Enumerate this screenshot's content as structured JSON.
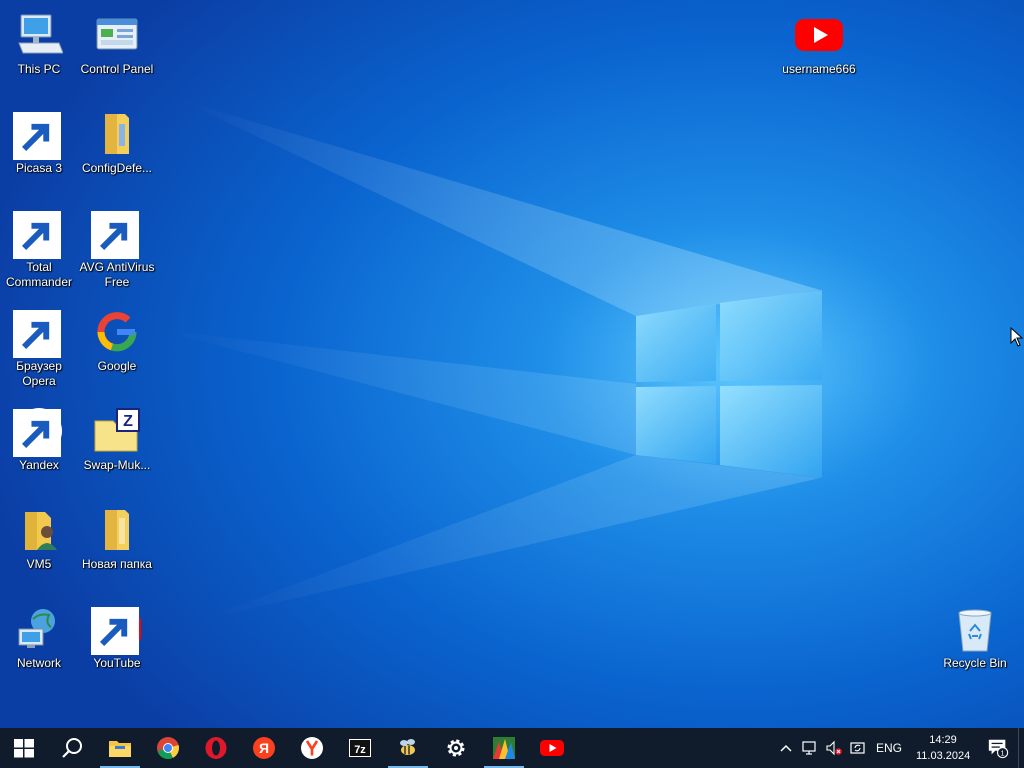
{
  "desktop": {
    "icons_left": [
      {
        "label": "This PC",
        "icon": "computer-icon"
      },
      {
        "label": "Control Panel",
        "icon": "control-panel-icon"
      },
      {
        "label": "Picasa 3",
        "icon": "picasa-icon"
      },
      {
        "label": "ConfigDefe...",
        "icon": "folder-icon"
      },
      {
        "label": "Total Commander",
        "icon": "floppy-icon"
      },
      {
        "label": "AVG AntiVirus Free",
        "icon": "avg-icon"
      },
      {
        "label": "Браузер Opera",
        "icon": "opera-icon"
      },
      {
        "label": "Google",
        "icon": "google-icon"
      },
      {
        "label": "Yandex",
        "icon": "yandex-icon"
      },
      {
        "label": "Swap-Muk...",
        "icon": "zip-folder-icon"
      },
      {
        "label": "VM5",
        "icon": "user-folder-icon"
      },
      {
        "label": "Новая папка",
        "icon": "folder-icon"
      },
      {
        "label": "Network",
        "icon": "network-icon"
      },
      {
        "label": "YouTube",
        "icon": "youtube-icon"
      }
    ],
    "icon_top_right": {
      "label": "username666",
      "icon": "youtube-icon"
    },
    "recycle_bin": {
      "label": "Recycle Bin",
      "icon": "recycle-bin-icon"
    }
  },
  "taskbar": {
    "pinned": [
      {
        "name": "start",
        "icon": "windows-logo-icon"
      },
      {
        "name": "search",
        "icon": "search-icon"
      },
      {
        "name": "file-explorer",
        "icon": "folder-icon"
      },
      {
        "name": "chrome",
        "icon": "chrome-icon"
      },
      {
        "name": "opera",
        "icon": "opera-icon"
      },
      {
        "name": "yandex-browser",
        "icon": "yandex-icon"
      },
      {
        "name": "yandex",
        "icon": "yandex-icon"
      },
      {
        "name": "7zip",
        "icon": "7z-icon"
      },
      {
        "name": "app-bee",
        "icon": "bee-icon"
      },
      {
        "name": "settings",
        "icon": "gear-icon"
      },
      {
        "name": "avg",
        "icon": "avg-icon"
      },
      {
        "name": "youtube",
        "icon": "youtube-icon"
      }
    ],
    "tray": {
      "language": "ENG",
      "time": "14:29",
      "date": "11.03.2024",
      "notification_count": "1"
    }
  },
  "colors": {
    "taskbar_bg": "#101c2c",
    "wallpaper_accent": "#0a5fc8",
    "active_indicator": "#76b9ed"
  }
}
